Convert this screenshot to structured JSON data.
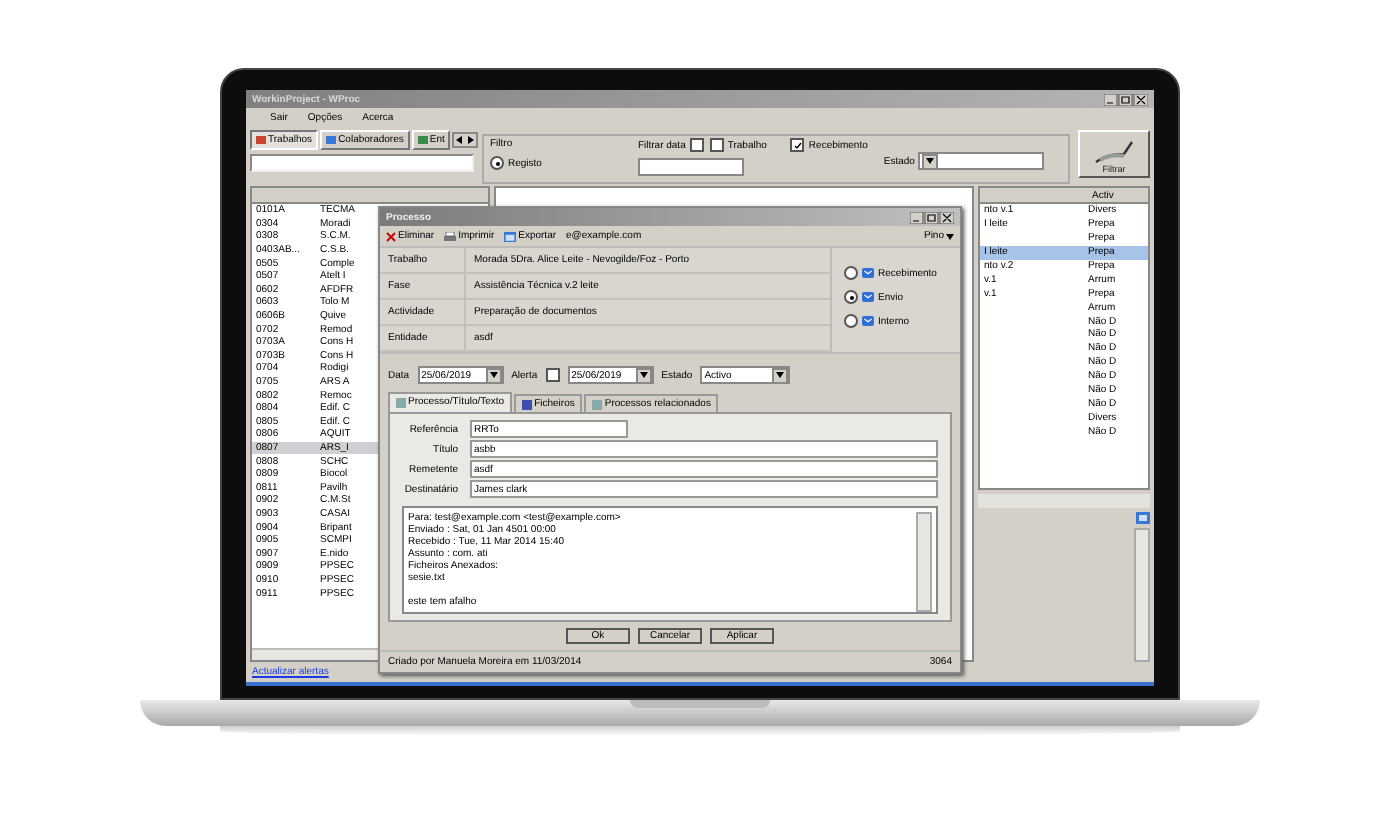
{
  "main_window": {
    "title": "WorkinProject - WProc",
    "menu": [
      "Sair",
      "Opções",
      "Acerca"
    ],
    "tabs": [
      {
        "label": "Trabalhos",
        "selected": true
      },
      {
        "label": "Colaboradores",
        "selected": false
      },
      {
        "label": "Ent",
        "selected": false
      }
    ],
    "filter": {
      "title": "Filtro",
      "registo": {
        "label": "Registo",
        "selected": true
      },
      "date_label": "Filtrar data",
      "date_checked": false,
      "checks": [
        {
          "label": "Trabalho",
          "checked": false
        },
        {
          "label": "Recebimento",
          "checked": true
        }
      ],
      "estado_label": "Estado",
      "button": "Filtrar"
    },
    "left_rows": [
      {
        "code": "0101A",
        "name": "TECMA",
        "selected": false
      },
      {
        "code": "0304",
        "name": "Moradi",
        "selected": false
      },
      {
        "code": "0308",
        "name": "S.C.M.",
        "selected": false
      },
      {
        "code": "0403AB...",
        "name": "C.S.B.",
        "selected": false
      },
      {
        "code": "0505",
        "name": "Comple",
        "selected": false
      },
      {
        "code": "0507",
        "name": "Atelt I",
        "selected": false
      },
      {
        "code": "0602",
        "name": "AFDFR",
        "selected": false
      },
      {
        "code": "0603",
        "name": "Tolo M",
        "selected": false
      },
      {
        "code": "0606B",
        "name": "Quive",
        "selected": false
      },
      {
        "code": "0702",
        "name": "Remod",
        "selected": false
      },
      {
        "code": "0703A",
        "name": "Cons H",
        "selected": false
      },
      {
        "code": "0703B",
        "name": "Cons H",
        "selected": false
      },
      {
        "code": "0704",
        "name": "Rodigi",
        "selected": false
      },
      {
        "code": "0705",
        "name": "ARS A",
        "selected": false
      },
      {
        "code": "0802",
        "name": "Remoc",
        "selected": false
      },
      {
        "code": "0804",
        "name": "Edif. C",
        "selected": false
      },
      {
        "code": "0805",
        "name": "Edif. C",
        "selected": false
      },
      {
        "code": "0806",
        "name": "AQUIT",
        "selected": false
      },
      {
        "code": "0807",
        "name": "ARS_I",
        "selected": true
      },
      {
        "code": "0808",
        "name": "SCHC",
        "selected": false
      },
      {
        "code": "0809",
        "name": "Biocol",
        "selected": false
      },
      {
        "code": "0811",
        "name": "Pavilh",
        "selected": false
      },
      {
        "code": "0902",
        "name": "C.M.St",
        "selected": false
      },
      {
        "code": "0903",
        "name": "CASAI",
        "selected": false
      },
      {
        "code": "0904",
        "name": "Bripant",
        "selected": false
      },
      {
        "code": "0905",
        "name": "SCMPI",
        "selected": false
      },
      {
        "code": "0907",
        "name": "E.nido",
        "selected": false
      },
      {
        "code": "0909",
        "name": "PPSEC",
        "selected": false
      },
      {
        "code": "0910",
        "name": "PPSEC",
        "selected": false
      },
      {
        "code": "0911",
        "name": "PPSEC",
        "selected": false
      }
    ],
    "right_header": "Activ",
    "right_rows": [
      {
        "text": "nto v.1",
        "activity": "Divers",
        "selected": false
      },
      {
        "text": "I leite",
        "activity": "Prepa",
        "selected": false
      },
      {
        "activity": "Prepa",
        "selected": false
      },
      {
        "text": "I leite",
        "activity": "Prepa",
        "selected": true
      },
      {
        "text": "nto v.2",
        "activity": "Prepa",
        "selected": false
      },
      {
        "text": "v.1",
        "activity": "Arrum",
        "selected": false
      },
      {
        "text": "v.1",
        "activity": "Prepa",
        "selected": false
      },
      {
        "activity": "Arrum",
        "selected": false
      },
      {
        "activity": "Não D",
        "selected": false
      },
      {
        "activity": "Não D",
        "selected": false
      },
      {
        "activity": "Não D",
        "selected": false
      },
      {
        "activity": "Não D",
        "selected": false
      },
      {
        "activity": "Não D",
        "selected": false
      },
      {
        "activity": "Não D",
        "selected": false
      },
      {
        "activity": "Não D",
        "selected": false
      },
      {
        "activity": "Divers",
        "selected": false
      },
      {
        "activity": "Não D",
        "selected": false
      }
    ],
    "link": "Actualizar alertas"
  },
  "dialog": {
    "title": "Processo",
    "toolbar": [
      {
        "label": "Eliminar",
        "kind": "delete"
      },
      {
        "label": "Imprimir",
        "kind": "print"
      },
      {
        "label": "Exportar",
        "kind": "export"
      },
      {
        "label": "e@example.com",
        "kind": "plain"
      }
    ],
    "pin": "Pino",
    "info": [
      {
        "label": "Trabalho",
        "value": "Morada 5Dra. Alice Leite - Nevogilde/Foz - Porto"
      },
      {
        "label": "Fase",
        "value": "Assistência Técnica v.2 leite"
      },
      {
        "label": "Actividade",
        "value": "Preparação de documentos"
      },
      {
        "label": "Entidade",
        "value": "asdf"
      }
    ],
    "direction": [
      {
        "label": "Recebimento",
        "selected": false
      },
      {
        "label": "Envio",
        "selected": true
      },
      {
        "label": "Interno",
        "selected": false
      }
    ],
    "data_label": "Data",
    "date": "25/06/2019",
    "alert_label": "Alerta",
    "alert_checked": false,
    "alert_date": "25/06/2019",
    "estado_label": "Estado",
    "estado": "Activo",
    "tabs": [
      {
        "label": "Processo/Título/Texto",
        "selected": true
      },
      {
        "label": "Ficheiros",
        "selected": false
      },
      {
        "label": "Processos relacionados",
        "selected": false
      }
    ],
    "fields": [
      {
        "label": "Referência",
        "value": "RRTo"
      },
      {
        "label": "Título",
        "value": "asbb"
      },
      {
        "label": "Remetente",
        "value": "asdf"
      },
      {
        "label": "Destinatário",
        "value": "James clark"
      }
    ],
    "message": "Para: test@example.com <test@example.com>\nEnviado : Sat, 01 Jan 4501 00:00\nRecebido : Tue, 11 Mar 2014 15:40\nAssunto : com. ati\nFicheiros Anexados:\n   sesie.txt\n\neste tem afalho",
    "buttons": [
      "Ok",
      "Cancelar",
      "Aplicar"
    ],
    "created": "Criado por Manuela Moreira em 11/03/2014",
    "number": "3064"
  }
}
